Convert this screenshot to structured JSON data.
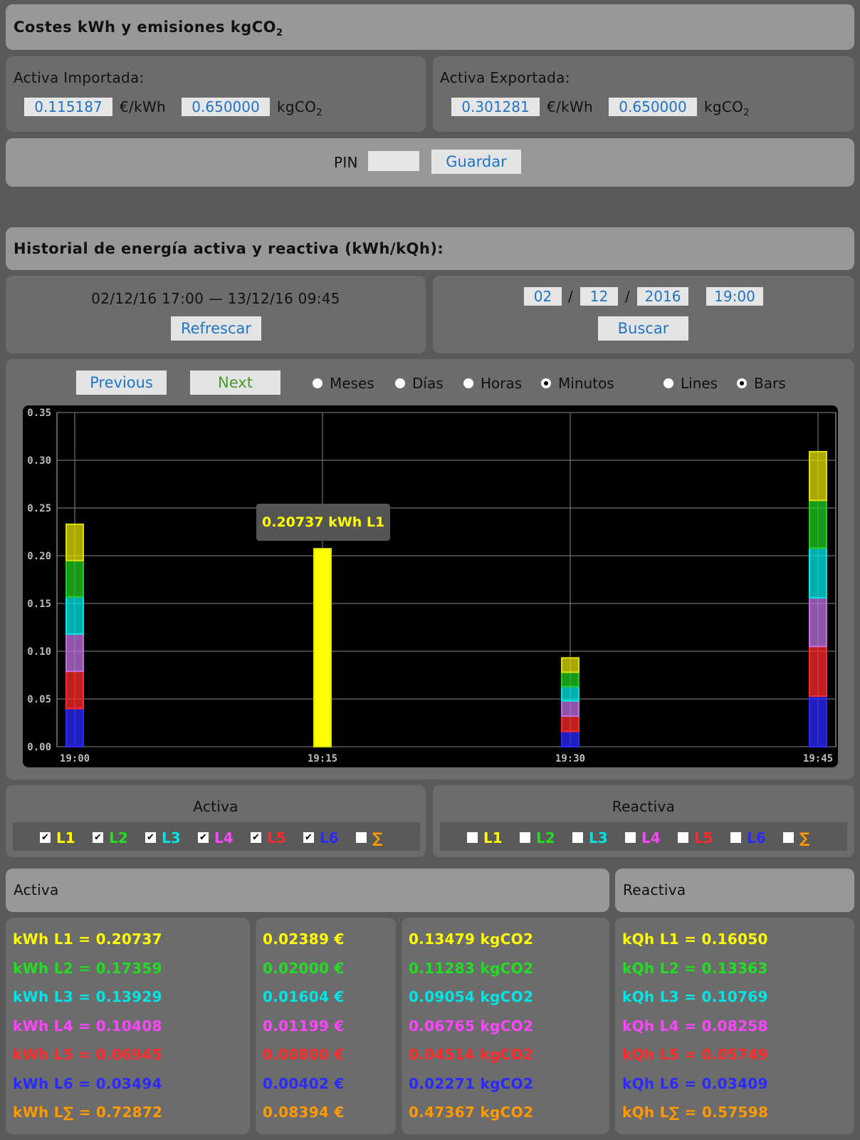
{
  "costs": {
    "title": "Costes kWh y emisiones kgCO",
    "title_sub": "2",
    "imported": {
      "label": "Activa Importada:",
      "price": "0.115187",
      "price_unit": "€/kWh",
      "co2": "0.650000",
      "co2_unit": "kgCO",
      "co2_sub": "2"
    },
    "exported": {
      "label": "Activa Exportada:",
      "price": "0.301281",
      "price_unit": "€/kWh",
      "co2": "0.650000",
      "co2_unit": "kgCO",
      "co2_sub": "2"
    },
    "pin_label": "PIN",
    "pin_value": "",
    "save_label": "Guardar"
  },
  "history": {
    "title": "Historial de energía activa y reactiva (kWh/kQh):",
    "range": "02/12/16 17:00 — 13/12/16 09:45",
    "refresh_label": "Refrescar",
    "date": {
      "day": "02",
      "month": "12",
      "year": "2016",
      "time": "19:00",
      "sep": "/"
    },
    "search_label": "Buscar"
  },
  "controls": {
    "previous_label": "Previous",
    "next_label": "Next",
    "period_options": [
      {
        "label": "Meses",
        "checked": false
      },
      {
        "label": "Días",
        "checked": false
      },
      {
        "label": "Horas",
        "checked": false
      },
      {
        "label": "Minutos",
        "checked": true
      }
    ],
    "style_options": [
      {
        "label": "Lines",
        "checked": false
      },
      {
        "label": "Bars",
        "checked": true
      }
    ]
  },
  "chart_data": {
    "type": "bar",
    "stacked": true,
    "categories": [
      "19:00",
      "19:15",
      "19:30",
      "19:45"
    ],
    "ylim": [
      0,
      0.35
    ],
    "yticks": [
      "0.00",
      "0.05",
      "0.10",
      "0.15",
      "0.20",
      "0.25",
      "0.30",
      "0.35"
    ],
    "grid": true,
    "series": [
      {
        "name": "L6",
        "color": "#2a2aff",
        "values": [
          0.04,
          0,
          0.016,
          0.053
        ]
      },
      {
        "name": "L5",
        "color": "#ff2a2a",
        "values": [
          0.039,
          0,
          0.016,
          0.052
        ]
      },
      {
        "name": "L4",
        "color": "#c070e0",
        "values": [
          0.039,
          0,
          0.016,
          0.051
        ]
      },
      {
        "name": "L3",
        "color": "#00e8e8",
        "values": [
          0.039,
          0,
          0.015,
          0.052
        ]
      },
      {
        "name": "L2",
        "color": "#22cc22",
        "values": [
          0.038,
          0,
          0.015,
          0.05
        ]
      },
      {
        "name": "L1",
        "color": "#e0e000",
        "values": [
          0.038,
          0.20737,
          0.015,
          0.051
        ]
      }
    ],
    "tooltip": "0.20737 kWh L1"
  },
  "activa_checks": {
    "title": "Activa",
    "items": [
      {
        "label": "L1",
        "checked": true,
        "color": "#ffff00"
      },
      {
        "label": "L2",
        "checked": true,
        "color": "#22dd22"
      },
      {
        "label": "L3",
        "checked": true,
        "color": "#00e5e5"
      },
      {
        "label": "L4",
        "checked": true,
        "color": "#ff44ff"
      },
      {
        "label": "L5",
        "checked": true,
        "color": "#ff2a2a"
      },
      {
        "label": "L6",
        "checked": true,
        "color": "#2a2aff"
      },
      {
        "label": "∑",
        "checked": false,
        "color": "#ff9900"
      }
    ]
  },
  "reactiva_checks": {
    "title": "Reactiva",
    "items": [
      {
        "label": "L1",
        "checked": false,
        "color": "#ffff00"
      },
      {
        "label": "L2",
        "checked": false,
        "color": "#22dd22"
      },
      {
        "label": "L3",
        "checked": false,
        "color": "#00e5e5"
      },
      {
        "label": "L4",
        "checked": false,
        "color": "#ff44ff"
      },
      {
        "label": "L5",
        "checked": false,
        "color": "#ff2a2a"
      },
      {
        "label": "L6",
        "checked": false,
        "color": "#2a2aff"
      },
      {
        "label": "∑",
        "checked": false,
        "color": "#ff9900"
      }
    ]
  },
  "results": {
    "activa_title": "Activa",
    "reactiva_title": "Reactiva",
    "colors": [
      "#ffff00",
      "#22dd22",
      "#00e5e5",
      "#ff44ff",
      "#ff2a2a",
      "#2a2aff",
      "#ff9900"
    ],
    "kwh": [
      "kWh L1 = 0.20737",
      "kWh L2 = 0.17359",
      "kWh L3 = 0.13929",
      "kWh L4 = 0.10408",
      "kWh L5 = 0.06945",
      "kWh L6 = 0.03494",
      "kWh L∑ = 0.72872"
    ],
    "eur": [
      "0.02389 €",
      "0.02000 €",
      "0.01604 €",
      "0.01199 €",
      "0.00800 €",
      "0.00402 €",
      "0.08394 €"
    ],
    "co2": [
      "0.13479 kgCO2",
      "0.11283 kgCO2",
      "0.09054 kgCO2",
      "0.06765 kgCO2",
      "0.04514 kgCO2",
      "0.02271 kgCO2",
      "0.47367 kgCO2"
    ],
    "kqh": [
      "kQh L1 = 0.16050",
      "kQh L2 = 0.13363",
      "kQh L3 = 0.10769",
      "kQh L4 = 0.08258",
      "kQh L5 = 0.05749",
      "kQh L6 = 0.03409",
      "kQh L∑ = 0.57598"
    ]
  }
}
